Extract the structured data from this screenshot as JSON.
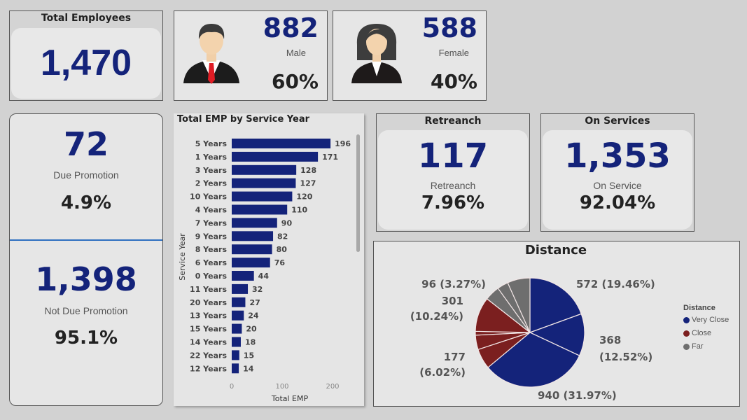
{
  "total": {
    "title": "Total Employees",
    "value": "1,470"
  },
  "male": {
    "value": "882",
    "label": "Male",
    "pct": "60%",
    "icon": "male-avatar-icon"
  },
  "female": {
    "value": "588",
    "label": "Female",
    "pct": "40%",
    "icon": "female-avatar-icon"
  },
  "promotion": {
    "due": {
      "value": "72",
      "label": "Due Promotion",
      "pct": "4.9%"
    },
    "not_due": {
      "value": "1,398",
      "label": "Not Due Promotion",
      "pct": "95.1%"
    }
  },
  "retreanch": {
    "title": "Retreanch",
    "value": "117",
    "label": "Retreanch",
    "pct": "7.96%"
  },
  "on_services": {
    "title": "On Services",
    "value": "1,353",
    "label": "On Service",
    "pct": "92.04%"
  },
  "colors": {
    "navy": "#14237a",
    "maroon": "#7b1f1f",
    "gray": "#6e6e6e"
  },
  "chart_data": [
    {
      "type": "bar",
      "orientation": "horizontal",
      "title": "Total EMP by Service Year",
      "xlabel": "Total EMP",
      "ylabel": "Service Year",
      "categories": [
        "5 Years",
        "1 Years",
        "3 Years",
        "2 Years",
        "10 Years",
        "4 Years",
        "7 Years",
        "9 Years",
        "8 Years",
        "6 Years",
        "0 Years",
        "11 Years",
        "20 Years",
        "13 Years",
        "15 Years",
        "14 Years",
        "22 Years",
        "12 Years"
      ],
      "values": [
        196,
        171,
        128,
        127,
        120,
        110,
        90,
        82,
        80,
        76,
        44,
        32,
        27,
        24,
        20,
        18,
        15,
        14
      ],
      "xticks": [
        "0",
        "100",
        "200"
      ],
      "xlim": [
        0,
        200
      ]
    },
    {
      "type": "pie",
      "title": "Distance",
      "legend_title": "Distance",
      "legend": [
        "Very Close",
        "Close",
        "Far"
      ],
      "legend_position": "right",
      "slices": [
        {
          "group": "Very Close",
          "value": 572,
          "label": "572 (19.46%)"
        },
        {
          "group": "Very Close",
          "value": 368,
          "label": "368 (12.52%)"
        },
        {
          "group": "Very Close",
          "value": 940,
          "label": "940 (31.97%)"
        },
        {
          "group": "Close",
          "value": 177,
          "label": "177 (6.02%)"
        },
        {
          "group": "Close",
          "value": 125,
          "label": ""
        },
        {
          "group": "Close",
          "value": 33,
          "label": ""
        },
        {
          "group": "Close",
          "value": 301,
          "label": "301 (10.24%)"
        },
        {
          "group": "Far",
          "value": 131,
          "label": ""
        },
        {
          "group": "Far",
          "value": 96,
          "label": "96 (3.27%)"
        },
        {
          "group": "Far",
          "value": 197,
          "label": ""
        }
      ]
    }
  ]
}
